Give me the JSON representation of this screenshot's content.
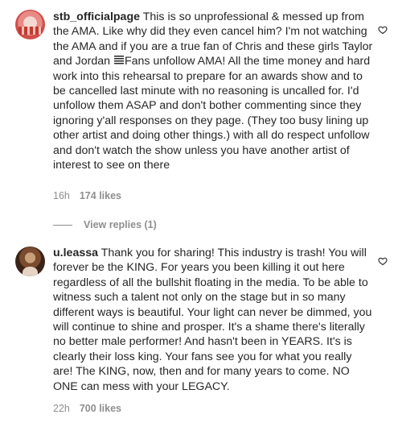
{
  "comments": [
    {
      "username": "stb_officialpage",
      "text_before_emoji": "This is so unprofessional & messed up from the AMA. Like why did they even cancel him? I'm not watching the AMA and if you are a true fan of Chris and these girls Taylor and Jordan",
      "emoji": "notepad-emoji",
      "text_after_emoji": "Fans unfollow AMA! All the time money and hard work into this rehearsal to prepare for an awards show and to be cancelled last minute with no reasoning is uncalled for. I'd unfollow them ASAP and don't bother commenting since they ignoring y'all responses on they page. (They too busy lining up other artist and doing other things.) with all do respect unfollow and don't watch the show unless you have another artist of interest to see on there",
      "time": "16h",
      "likes": "174 likes",
      "view_replies": "View replies (1)"
    },
    {
      "username": "u.leassa",
      "text": "Thank you for sharing! This industry is trash! You will forever be the KING. For years you been killing it out here regardless of all the bullshit floating in the media. To be able to witness such a talent not only on the stage but in so many different ways is beautiful. Your light can never be dimmed, you will continue to shine and prosper. It's a shame there's literally no better male performer! And hasn't been in YEARS. It's is clearly their loss king. Your fans see you for what you really are! The KING, now, then and for many years to come. NO ONE can mess with your LEGACY.",
      "time": "22h",
      "likes": "700 likes"
    }
  ],
  "icons": {
    "like": "heart-outline-icon"
  },
  "colors": {
    "text": "#262626",
    "secondary": "#8e8e8e",
    "background": "#ffffff"
  }
}
